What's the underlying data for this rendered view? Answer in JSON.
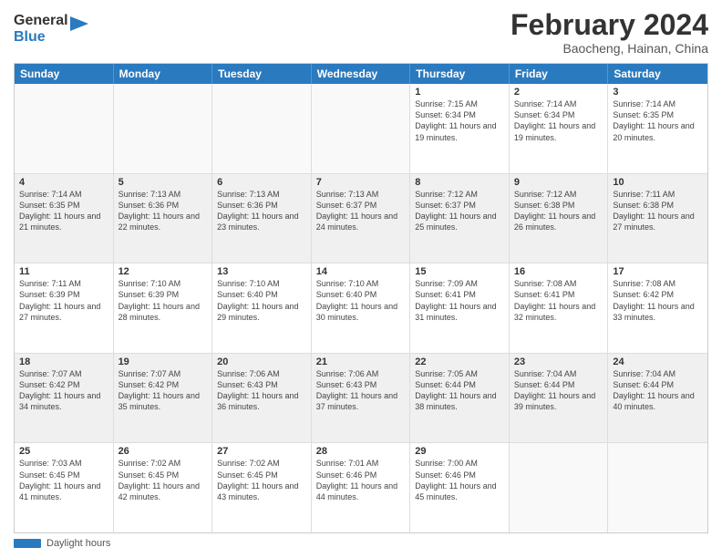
{
  "logo": {
    "general": "General",
    "blue": "Blue"
  },
  "title": "February 2024",
  "subtitle": "Baocheng, Hainan, China",
  "days_of_week": [
    "Sunday",
    "Monday",
    "Tuesday",
    "Wednesday",
    "Thursday",
    "Friday",
    "Saturday"
  ],
  "weeks": [
    [
      {
        "day": "",
        "info": ""
      },
      {
        "day": "",
        "info": ""
      },
      {
        "day": "",
        "info": ""
      },
      {
        "day": "",
        "info": ""
      },
      {
        "day": "1",
        "info": "Sunrise: 7:15 AM\nSunset: 6:34 PM\nDaylight: 11 hours and 19 minutes."
      },
      {
        "day": "2",
        "info": "Sunrise: 7:14 AM\nSunset: 6:34 PM\nDaylight: 11 hours and 19 minutes."
      },
      {
        "day": "3",
        "info": "Sunrise: 7:14 AM\nSunset: 6:35 PM\nDaylight: 11 hours and 20 minutes."
      }
    ],
    [
      {
        "day": "4",
        "info": "Sunrise: 7:14 AM\nSunset: 6:35 PM\nDaylight: 11 hours and 21 minutes."
      },
      {
        "day": "5",
        "info": "Sunrise: 7:13 AM\nSunset: 6:36 PM\nDaylight: 11 hours and 22 minutes."
      },
      {
        "day": "6",
        "info": "Sunrise: 7:13 AM\nSunset: 6:36 PM\nDaylight: 11 hours and 23 minutes."
      },
      {
        "day": "7",
        "info": "Sunrise: 7:13 AM\nSunset: 6:37 PM\nDaylight: 11 hours and 24 minutes."
      },
      {
        "day": "8",
        "info": "Sunrise: 7:12 AM\nSunset: 6:37 PM\nDaylight: 11 hours and 25 minutes."
      },
      {
        "day": "9",
        "info": "Sunrise: 7:12 AM\nSunset: 6:38 PM\nDaylight: 11 hours and 26 minutes."
      },
      {
        "day": "10",
        "info": "Sunrise: 7:11 AM\nSunset: 6:38 PM\nDaylight: 11 hours and 27 minutes."
      }
    ],
    [
      {
        "day": "11",
        "info": "Sunrise: 7:11 AM\nSunset: 6:39 PM\nDaylight: 11 hours and 27 minutes."
      },
      {
        "day": "12",
        "info": "Sunrise: 7:10 AM\nSunset: 6:39 PM\nDaylight: 11 hours and 28 minutes."
      },
      {
        "day": "13",
        "info": "Sunrise: 7:10 AM\nSunset: 6:40 PM\nDaylight: 11 hours and 29 minutes."
      },
      {
        "day": "14",
        "info": "Sunrise: 7:10 AM\nSunset: 6:40 PM\nDaylight: 11 hours and 30 minutes."
      },
      {
        "day": "15",
        "info": "Sunrise: 7:09 AM\nSunset: 6:41 PM\nDaylight: 11 hours and 31 minutes."
      },
      {
        "day": "16",
        "info": "Sunrise: 7:08 AM\nSunset: 6:41 PM\nDaylight: 11 hours and 32 minutes."
      },
      {
        "day": "17",
        "info": "Sunrise: 7:08 AM\nSunset: 6:42 PM\nDaylight: 11 hours and 33 minutes."
      }
    ],
    [
      {
        "day": "18",
        "info": "Sunrise: 7:07 AM\nSunset: 6:42 PM\nDaylight: 11 hours and 34 minutes."
      },
      {
        "day": "19",
        "info": "Sunrise: 7:07 AM\nSunset: 6:42 PM\nDaylight: 11 hours and 35 minutes."
      },
      {
        "day": "20",
        "info": "Sunrise: 7:06 AM\nSunset: 6:43 PM\nDaylight: 11 hours and 36 minutes."
      },
      {
        "day": "21",
        "info": "Sunrise: 7:06 AM\nSunset: 6:43 PM\nDaylight: 11 hours and 37 minutes."
      },
      {
        "day": "22",
        "info": "Sunrise: 7:05 AM\nSunset: 6:44 PM\nDaylight: 11 hours and 38 minutes."
      },
      {
        "day": "23",
        "info": "Sunrise: 7:04 AM\nSunset: 6:44 PM\nDaylight: 11 hours and 39 minutes."
      },
      {
        "day": "24",
        "info": "Sunrise: 7:04 AM\nSunset: 6:44 PM\nDaylight: 11 hours and 40 minutes."
      }
    ],
    [
      {
        "day": "25",
        "info": "Sunrise: 7:03 AM\nSunset: 6:45 PM\nDaylight: 11 hours and 41 minutes."
      },
      {
        "day": "26",
        "info": "Sunrise: 7:02 AM\nSunset: 6:45 PM\nDaylight: 11 hours and 42 minutes."
      },
      {
        "day": "27",
        "info": "Sunrise: 7:02 AM\nSunset: 6:45 PM\nDaylight: 11 hours and 43 minutes."
      },
      {
        "day": "28",
        "info": "Sunrise: 7:01 AM\nSunset: 6:46 PM\nDaylight: 11 hours and 44 minutes."
      },
      {
        "day": "29",
        "info": "Sunrise: 7:00 AM\nSunset: 6:46 PM\nDaylight: 11 hours and 45 minutes."
      },
      {
        "day": "",
        "info": ""
      },
      {
        "day": "",
        "info": ""
      }
    ]
  ],
  "footer": {
    "label": "Daylight hours"
  }
}
